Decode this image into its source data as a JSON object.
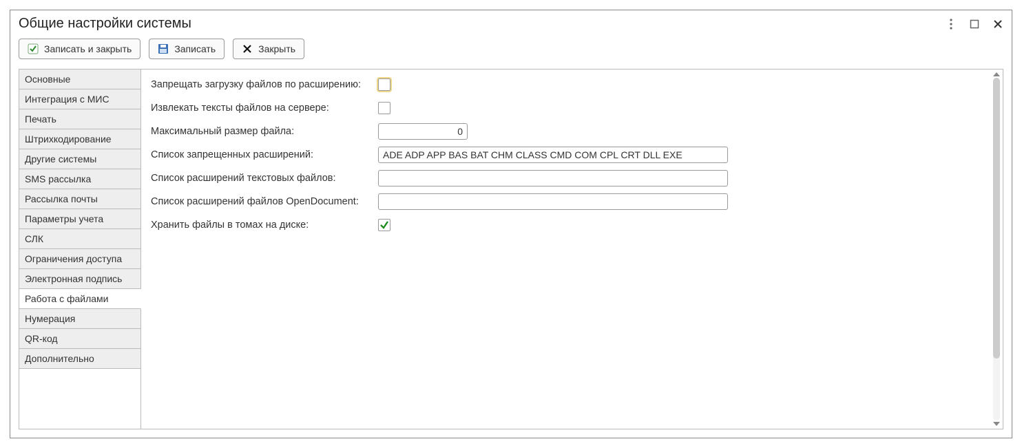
{
  "title": "Общие настройки системы",
  "toolbar": {
    "save_close": "Записать и закрыть",
    "save": "Записать",
    "close": "Закрыть"
  },
  "tabs": [
    "Основные",
    "Интеграция с МИС",
    "Печать",
    "Штрихкодирование",
    "Другие системы",
    "SMS рассылка",
    "Рассылка почты",
    "Параметры учета",
    "СЛК",
    "Ограничения доступа",
    "Электронная подпись",
    "Работа с файлами",
    "Нумерация",
    "QR-код",
    "Дополнительно"
  ],
  "active_tab_index": 11,
  "fields": {
    "forbid_upload_label": "Запрещать загрузку файлов по расширению:",
    "forbid_upload_checked": false,
    "extract_text_label": "Извлекать тексты файлов на сервере:",
    "extract_text_checked": false,
    "max_size_label": "Максимальный размер файла:",
    "max_size_value": "0",
    "forbidden_ext_label": "Список запрещенных расширений:",
    "forbidden_ext_value": "ADE ADP APP BAS BAT CHM CLASS CMD COM CPL CRT DLL EXE",
    "text_ext_label": "Список расширений текстовых файлов:",
    "text_ext_value": "",
    "od_ext_label": "Список расширений файлов OpenDocument:",
    "od_ext_value": "",
    "store_volumes_label": "Хранить файлы в томах на диске:",
    "store_volumes_checked": true
  }
}
